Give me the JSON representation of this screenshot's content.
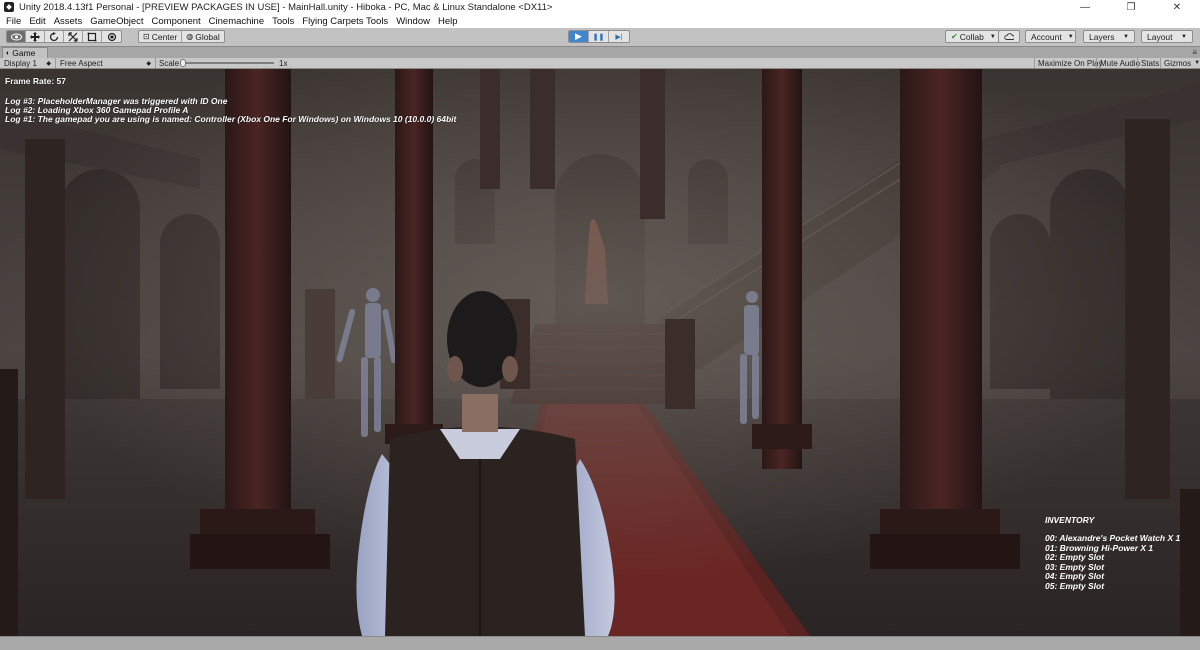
{
  "window": {
    "title": "Unity 2018.4.13f1 Personal - [PREVIEW PACKAGES IN USE] - MainHall.unity - Hiboka - PC, Mac & Linux Standalone <DX11>",
    "minimize": "—",
    "maximize": "❐",
    "close": "✕"
  },
  "menu": [
    "File",
    "Edit",
    "Assets",
    "GameObject",
    "Component",
    "Cinemachine",
    "Tools",
    "Flying Carpets Tools",
    "Window",
    "Help"
  ],
  "toolbar": {
    "tools": [
      "hand-icon",
      "move-icon",
      "rotate-icon",
      "scale-icon",
      "rect-icon",
      "transform-icon"
    ],
    "pivot_label": "Center",
    "space_label": "Global",
    "play_icon": "▶",
    "pause_icon": "❚❚",
    "step_icon": "▶|",
    "collab_label": "Collab",
    "account_label": "Account",
    "layers_label": "Layers",
    "layout_label": "Layout"
  },
  "game_tab": {
    "label": "Game",
    "display": "Display 1",
    "aspect": "Free Aspect",
    "scale_label": "Scale",
    "scale_value": "1x",
    "maximize_on_play": "Maximize On Play",
    "mute_audio": "Mute Audio",
    "stats": "Stats",
    "gizmos": "Gizmos"
  },
  "hud": {
    "frame_rate": "Frame Rate: 57",
    "logs": [
      "Log #3: PlaceholderManager was triggered with ID One",
      "Log #2: Loading Xbox 360 Gamepad Profile A",
      "Log #1: The gamepad you are using is named: Controller (Xbox One For Windows) on Windows 10  (10.0.0) 64bit"
    ],
    "inventory_title": "INVENTORY",
    "inventory": [
      "00: Alexandre's Pocket Watch X 1",
      "01: Browning Hi-Power X 1",
      "02: Empty Slot",
      "03: Empty Slot",
      "04: Empty Slot",
      "05: Empty Slot"
    ]
  },
  "colors": {
    "editor_bg": "#c2c2c2",
    "play_active": "#3f86cf",
    "scene_fog": "#4a4440"
  }
}
